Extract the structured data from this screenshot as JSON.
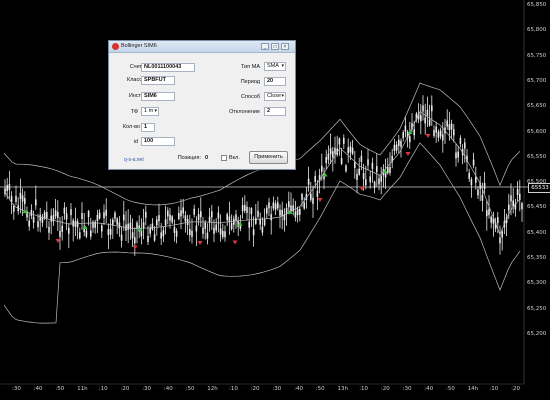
{
  "chart": {
    "current_price": "65533",
    "price_labels": [
      "65,850",
      "65,800",
      "65,750",
      "65,700",
      "65,650",
      "65,600",
      "65,550",
      "65,500",
      "65,450",
      "65,400",
      "65,350",
      "65,300",
      "65,250",
      "65,200"
    ],
    "time_labels": [
      ":30",
      ":40",
      ":50",
      "11h",
      ":10",
      ":20",
      ":30",
      ":40",
      ":50",
      "12h",
      ":10",
      ":20",
      ":30",
      ":40",
      ":50",
      "13h",
      ":10",
      ":20",
      ":30",
      ":40",
      ":50",
      "14h",
      ":10",
      ":20"
    ],
    "colors": {
      "background": "#000000",
      "candle": "#e8e8e8",
      "band": "#bdbdbd",
      "buy_marker": "#3fbf3f",
      "sell_marker": "#d83a3a",
      "price_line": "#cfcfcf"
    }
  },
  "dialog": {
    "title": "Bollinger SIM6",
    "title_icon": "app-icon",
    "buttons": {
      "minimize": "_",
      "maximize": "□",
      "close": "×"
    },
    "account_label": "Счет",
    "account_value": "NL0011100043",
    "class_label": "Класс",
    "class_value": "SPBFUT",
    "instrument_label": "Инст.",
    "instrument_value": "SIM6",
    "tf_label": "ТФ",
    "tf_value": "1 m",
    "qty_label": "Кол-во",
    "qty_value": "1",
    "id_label": "id",
    "id_value": "100",
    "ma_type_label": "Тип MA",
    "ma_type_value": "SMA",
    "period_label": "Период",
    "period_value": "20",
    "method_label": "Способ",
    "method_value": "Close",
    "deviation_label": "Отклонение",
    "deviation_value": "2",
    "position_label": "Позиция:",
    "position_value": "0",
    "enabled_label": "Вкл.",
    "apply_label": "Применить",
    "site_link": "q-s-a.net"
  }
}
